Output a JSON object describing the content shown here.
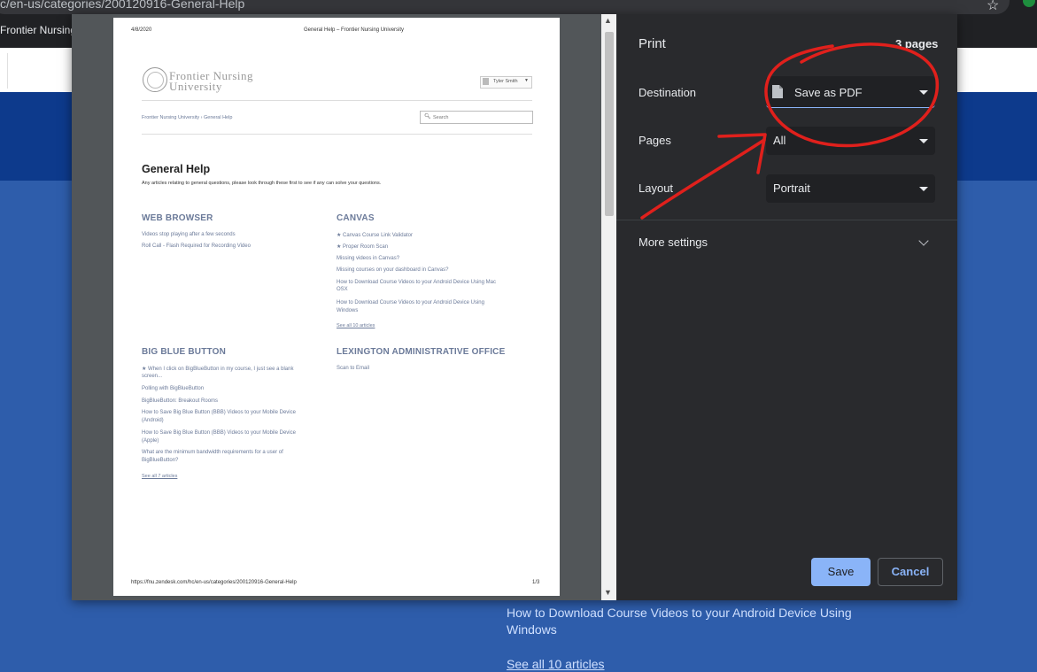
{
  "browser": {
    "url": "c/en-us/categories/200120916-General-Help",
    "bookmark_tab": "Frontier Nursing"
  },
  "background_site": {
    "article_line1": "How to Download Course Videos to your Android Device Using",
    "article_line2": "Windows",
    "see_all": "See all 10 articles"
  },
  "preview": {
    "header_date": "4/8/2020",
    "header_title": "General Help – Frontier Nursing University",
    "logo_line1": "Frontier Nursing",
    "logo_line2": "University",
    "user_name": "Tyler Smith",
    "breadcrumb": "Frontier Nursing University › General Help",
    "search_placeholder": "Search",
    "page_title": "General Help",
    "page_desc": "Any articles relating to general questions, please look through these first to see if any can solve your questions.",
    "sections": {
      "web_browser": {
        "title": "WEB BROWSER",
        "items": [
          "Videos stop playing after a few seconds",
          "Roll Call - Flash Required for Recording Video"
        ]
      },
      "canvas": {
        "title": "CANVAS",
        "items": [
          "★  Canvas Course Link Validator",
          "★  Proper Room Scan",
          "Missing videos in Canvas?",
          "Missing courses on your dashboard in Canvas?",
          "How to Download Course Videos to your Android Device Using Mac",
          "OSX",
          "How to Download Course Videos to your Android Device Using",
          "Windows"
        ],
        "see_all": "See all 10 articles"
      },
      "big_blue_button": {
        "title": "BIG BLUE BUTTON",
        "items": [
          "★  When I click on BigBlueButton in my course, I just see a blank",
          "screen...",
          "Polling with BigBlueButton",
          "BigBlueButton: Breakout Rooms",
          "How to Save Big Blue Button (BBB) Videos to your Mobile Device",
          "(Android)",
          "How to Save Big Blue Button (BBB) Videos to your Mobile Device",
          "(Apple)",
          "What are the minimum bandwidth requirements for a user of",
          "BigBlueButton?"
        ],
        "see_all": "See all 7 articles"
      },
      "lexington": {
        "title": "LEXINGTON ADMINISTRATIVE OFFICE",
        "items": [
          "Scan to Email"
        ]
      }
    },
    "footer_url": "https://fnu.zendesk.com/hc/en-us/categories/200120916-General-Help",
    "footer_page": "1/3"
  },
  "print_panel": {
    "title": "Print",
    "pages_count": "3 pages",
    "destination_label": "Destination",
    "destination_value": "Save as PDF",
    "pages_label": "Pages",
    "pages_value": "All",
    "layout_label": "Layout",
    "layout_value": "Portrait",
    "more_settings": "More settings",
    "save": "Save",
    "cancel": "Cancel"
  },
  "colors": {
    "annotation_red": "#e0201c",
    "accent_blue": "#8ab4f8",
    "panel_bg": "#292a2d"
  }
}
